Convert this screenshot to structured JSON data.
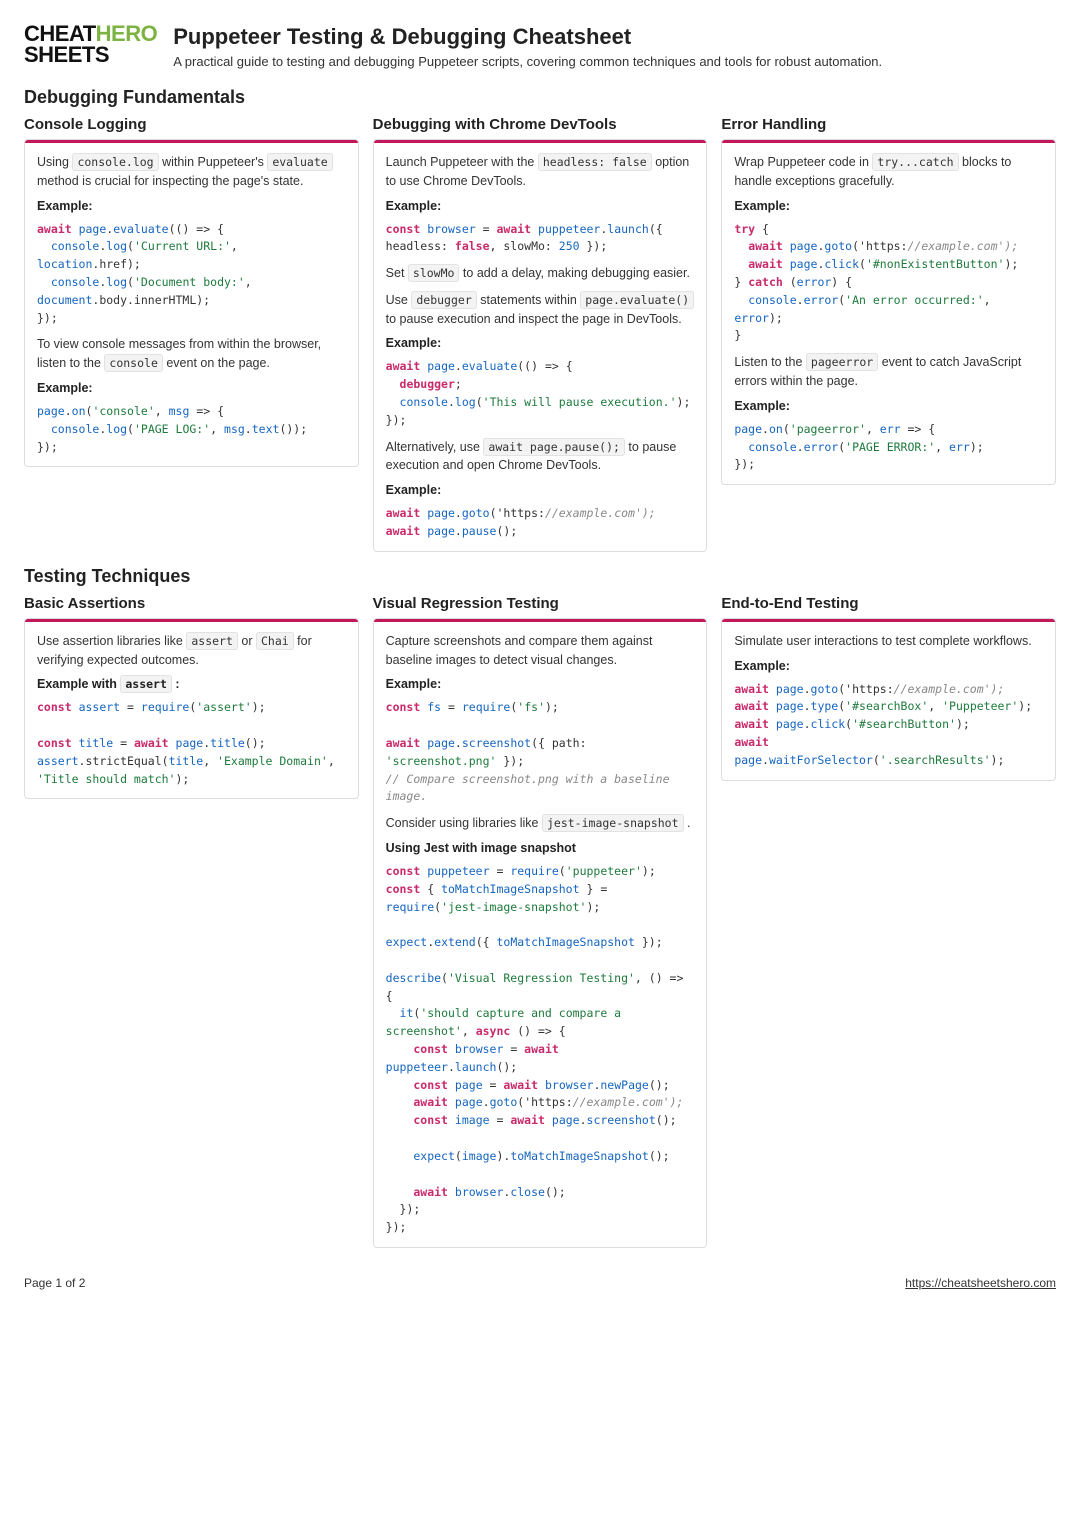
{
  "logo": {
    "line1a": "CHEAT",
    "line1b": "HERO",
    "line2": "SHEETS"
  },
  "page": {
    "title": "Puppeteer Testing & Debugging Cheatsheet",
    "subtitle": "A practical guide to testing and debugging Puppeteer scripts, covering common techniques and tools for robust automation."
  },
  "sections": {
    "debugging": {
      "heading": "Debugging Fundamentals",
      "console": {
        "title": "Console Logging",
        "intro_a": "Using ",
        "intro_code1": "console.log",
        "intro_b": " within Puppeteer's ",
        "intro_code2": "evaluate",
        "intro_c": " method is crucial for inspecting the page's state.",
        "example_label": "Example:",
        "code1": "await page.evaluate(() => {\n  console.log('Current URL:', location.href);\n  console.log('Document body:', document.body.innerHTML);\n});",
        "mid_a": "To view console messages from within the browser, listen to the ",
        "mid_code": "console",
        "mid_b": " event on the page.",
        "code2": "page.on('console', msg => {\n  console.log('PAGE LOG:', msg.text());\n});"
      },
      "devtools": {
        "title": "Debugging with Chrome DevTools",
        "intro_a": "Launch Puppeteer with the ",
        "intro_code": "headless: false",
        "intro_b": " option to use Chrome DevTools.",
        "example_label": "Example:",
        "code1": "const browser = await puppeteer.launch({ headless: false, slowMo: 250 });",
        "mid1_a": "Set ",
        "mid1_code": "slowMo",
        "mid1_b": " to add a delay, making debugging easier.",
        "mid2_a": "Use ",
        "mid2_code1": "debugger",
        "mid2_b": " statements within ",
        "mid2_code2": "page.evaluate()",
        "mid2_c": " to pause execution and inspect the page in DevTools.",
        "code2": "await page.evaluate(() => {\n  debugger;\n  console.log('This will pause execution.');\n});",
        "mid3_a": "Alternatively, use ",
        "mid3_code": "await page.pause();",
        "mid3_b": " to pause execution and open Chrome DevTools.",
        "code3": "await page.goto('https://example.com');\nawait page.pause();"
      },
      "errors": {
        "title": "Error Handling",
        "intro_a": "Wrap Puppeteer code in ",
        "intro_code": "try...catch",
        "intro_b": " blocks to handle exceptions gracefully.",
        "example_label": "Example:",
        "code1": "try {\n  await page.goto('https://example.com');\n  await page.click('#nonExistentButton');\n} catch (error) {\n  console.error('An error occurred:', error);\n}",
        "mid_a": "Listen to the ",
        "mid_code": "pageerror",
        "mid_b": " event to catch JavaScript errors within the page.",
        "code2": "page.on('pageerror', err => {\n  console.error('PAGE ERROR:', err);\n});"
      }
    },
    "testing": {
      "heading": "Testing Techniques",
      "assertions": {
        "title": "Basic Assertions",
        "intro_a": "Use assertion libraries like ",
        "intro_code1": "assert",
        "intro_b": " or ",
        "intro_code2": "Chai",
        "intro_c": " for verifying expected outcomes.",
        "example_label_a": "Example with ",
        "example_label_code": "assert",
        "example_label_b": " :",
        "code1": "const assert = require('assert');\n\nconst title = await page.title();\nassert.strictEqual(title, 'Example Domain', 'Title should match');"
      },
      "visual": {
        "title": "Visual Regression Testing",
        "intro": "Capture screenshots and compare them against baseline images to detect visual changes.",
        "example_label": "Example:",
        "code1": "const fs = require('fs');\n\nawait page.screenshot({ path: 'screenshot.png' });\n// Compare screenshot.png with a baseline image.",
        "mid_a": "Consider using libraries like ",
        "mid_code": "jest-image-snapshot",
        "mid_b": " .",
        "sub_label": "Using Jest with image snapshot",
        "code2": "const puppeteer = require('puppeteer');\nconst { toMatchImageSnapshot } = require('jest-image-snapshot');\n\nexpect.extend({ toMatchImageSnapshot });\n\ndescribe('Visual Regression Testing', () => {\n  it('should capture and compare a screenshot', async () => {\n    const browser = await puppeteer.launch();\n    const page = await browser.newPage();\n    await page.goto('https://example.com');\n    const image = await page.screenshot();\n\n    expect(image).toMatchImageSnapshot();\n\n    await browser.close();\n  });\n});"
      },
      "e2e": {
        "title": "End-to-End Testing",
        "intro": "Simulate user interactions to test complete workflows.",
        "example_label": "Example:",
        "code1": "await page.goto('https://example.com');\nawait page.type('#searchBox', 'Puppeteer');\nawait page.click('#searchButton');\nawait page.waitForSelector('.searchResults');"
      }
    }
  },
  "footer": {
    "page": "Page 1 of 2",
    "url": "https://cheatsheetshero.com"
  }
}
